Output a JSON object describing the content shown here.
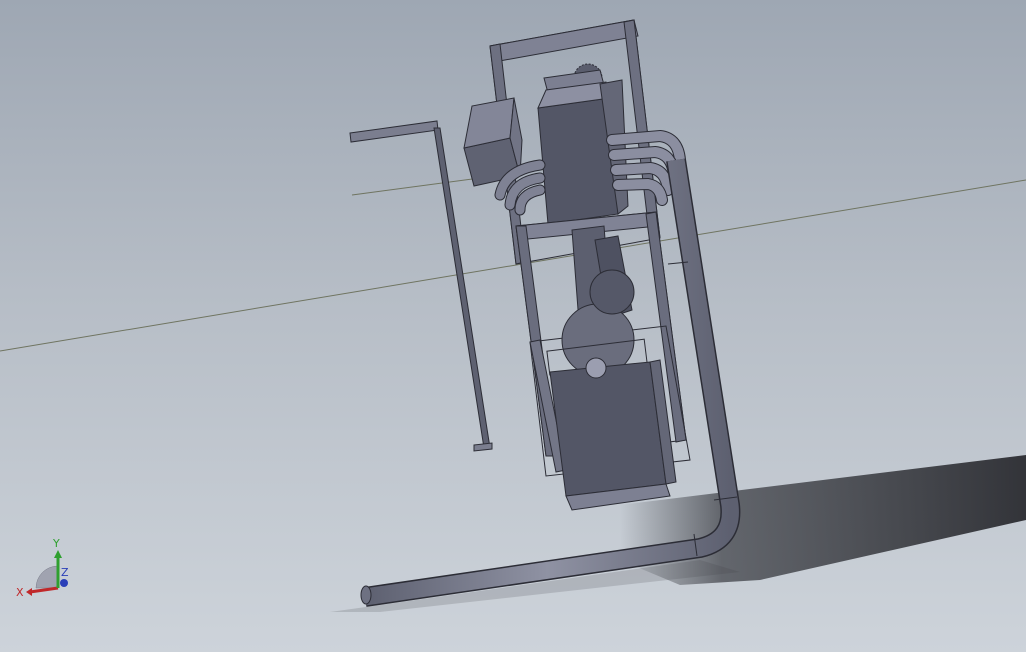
{
  "viewport": {
    "background_top": "#9ea7b3",
    "background_bottom": "#cdd3da"
  },
  "model": {
    "part_color": "#6e7182",
    "part_dark": "#595c6c",
    "part_light": "#8c8fa0",
    "edge_color": "#2c2d36",
    "shadow_color": "#383a40"
  },
  "triad": {
    "x_label": "X",
    "y_label": "Y",
    "z_label": "Z",
    "x_color": "#c0282a",
    "y_color": "#2fa02f",
    "z_color": "#2a3fb8"
  }
}
